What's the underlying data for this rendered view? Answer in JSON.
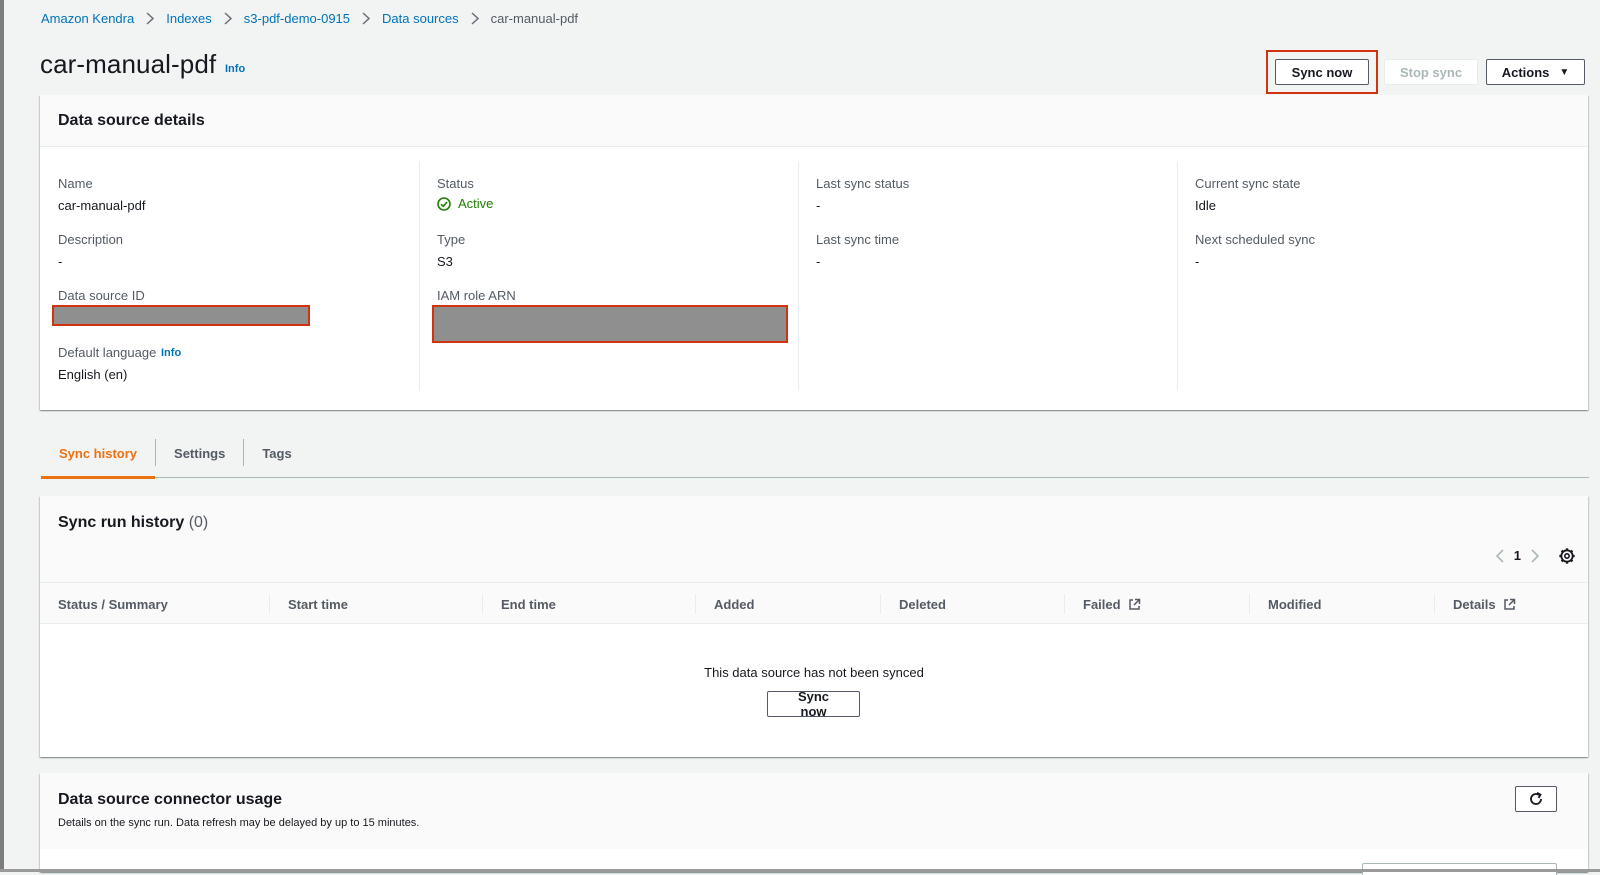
{
  "breadcrumb": {
    "items": [
      "Amazon Kendra",
      "Indexes",
      "s3-pdf-demo-0915",
      "Data sources"
    ],
    "current": "car-manual-pdf"
  },
  "page": {
    "title": "car-manual-pdf",
    "info": "Info"
  },
  "header_actions": {
    "sync_now": "Sync now",
    "stop_sync": "Stop sync",
    "actions": "Actions"
  },
  "details": {
    "title": "Data source details",
    "name_label": "Name",
    "name_value": "car-manual-pdf",
    "description_label": "Description",
    "description_value": "-",
    "data_source_id_label": "Data source ID",
    "default_language_label": "Default language",
    "default_language_info": "Info",
    "default_language_value": "English (en)",
    "status_label": "Status",
    "status_value": "Active",
    "type_label": "Type",
    "type_value": "S3",
    "iam_role_label": "IAM role ARN",
    "last_sync_status_label": "Last sync status",
    "last_sync_status_value": "-",
    "last_sync_time_label": "Last sync time",
    "last_sync_time_value": "-",
    "current_sync_state_label": "Current sync state",
    "current_sync_state_value": "Idle",
    "next_scheduled_sync_label": "Next scheduled sync",
    "next_scheduled_sync_value": "-"
  },
  "tabs": [
    "Sync history",
    "Settings",
    "Tags"
  ],
  "sync_history": {
    "title": "Sync run history",
    "count": "(0)",
    "page": "1",
    "columns": [
      "Status / Summary",
      "Start time",
      "End time",
      "Added",
      "Deleted",
      "Failed",
      "Modified",
      "Details"
    ],
    "empty_message": "This data source has not been synced",
    "empty_button": "Sync now"
  },
  "connector_usage": {
    "title": "Data source connector usage",
    "description": "Details on the sync run. Data refresh may be delayed by up to 15 minutes."
  },
  "colors": {
    "link": "#0073bb",
    "active_tab": "#ec7211",
    "status_active": "#1d8102",
    "highlight": "#d13212"
  }
}
